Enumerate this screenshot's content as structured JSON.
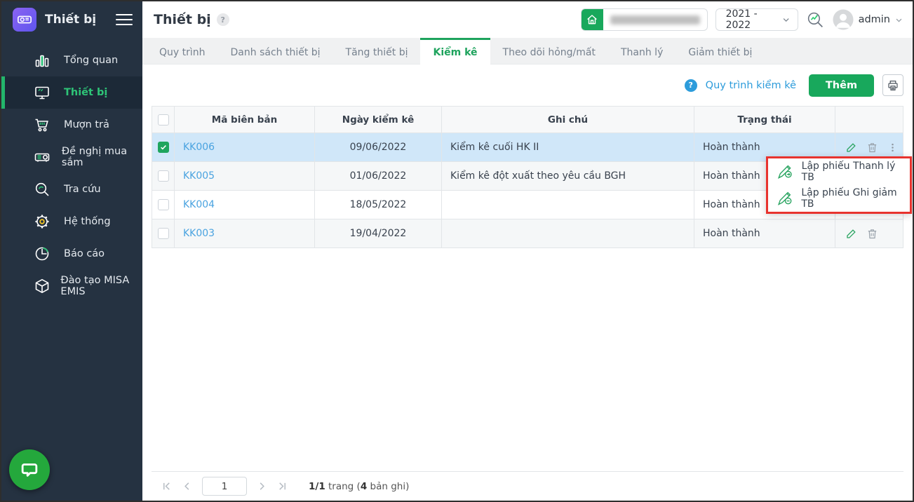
{
  "sidebar": {
    "app_title": "Thiết bị",
    "items": [
      {
        "label": "Tổng quan",
        "icon": "bar-chart-icon"
      },
      {
        "label": "Thiết bị",
        "icon": "monitor-icon",
        "active": true
      },
      {
        "label": "Mượn trả",
        "icon": "cart-icon"
      },
      {
        "label": "Đề nghị mua sắm",
        "icon": "projector-icon"
      },
      {
        "label": "Tra cứu",
        "icon": "search-icon"
      },
      {
        "label": "Hệ thống",
        "icon": "gear-icon"
      },
      {
        "label": "Báo cáo",
        "icon": "pie-chart-icon"
      },
      {
        "label": "Đào tạo MISA EMIS",
        "icon": "cube-icon"
      }
    ]
  },
  "header": {
    "page_title": "Thiết bị",
    "help_badge": "?",
    "school_year": "2021 - 2022",
    "username": "admin"
  },
  "tabs": {
    "active": "Kiểm kê",
    "items": [
      {
        "label": "Quy trình"
      },
      {
        "label": "Danh sách thiết bị"
      },
      {
        "label": "Tăng thiết bị"
      },
      {
        "label": "Kiểm kê"
      },
      {
        "label": "Theo dõi hỏng/mất"
      },
      {
        "label": "Thanh lý"
      },
      {
        "label": "Giảm thiết bị"
      }
    ]
  },
  "toolbar": {
    "help_badge": "?",
    "process_link": "Quy trình kiểm kê",
    "add_button": "Thêm"
  },
  "table": {
    "headers": {
      "code": "Mã biên bản",
      "date": "Ngày kiểm kê",
      "note": "Ghi chú",
      "status": "Trạng thái"
    },
    "rows": [
      {
        "code": "KK006",
        "date": "09/06/2022",
        "note": "Kiểm kê cuối HK II",
        "status": "Hoàn thành",
        "selected": true,
        "actions": [
          "edit-icon",
          "trash-icon",
          "kebab-icon"
        ]
      },
      {
        "code": "KK005",
        "date": "01/06/2022",
        "note": "Kiểm kê đột xuất theo yêu cầu BGH",
        "status": "Hoàn thành",
        "actions": []
      },
      {
        "code": "KK004",
        "date": "18/05/2022",
        "note": "",
        "status": "Hoàn thành",
        "actions": []
      },
      {
        "code": "KK003",
        "date": "19/04/2022",
        "note": "",
        "status": "Hoàn thành",
        "actions": [
          "edit-icon",
          "trash-icon"
        ]
      }
    ]
  },
  "context_menu": {
    "item1": "Lập phiếu Thanh lý TB",
    "item2": "Lập phiếu Ghi giảm TB",
    "icon1": "pen-arrow-icon",
    "icon2": "pen-minus-icon",
    "highlight_color": "#e8332e"
  },
  "pagination": {
    "page_value": "1",
    "pages_bold": "1/1",
    "mid_text": " trang (",
    "count_bold": "4",
    "end_text": " bản ghi)"
  },
  "colors": {
    "accent_green": "#18a85c",
    "link_blue": "#2d9cdb",
    "sidebar_bg": "#253241",
    "selected_row": "#d0e7f9",
    "annotation_red": "#e8332e"
  }
}
